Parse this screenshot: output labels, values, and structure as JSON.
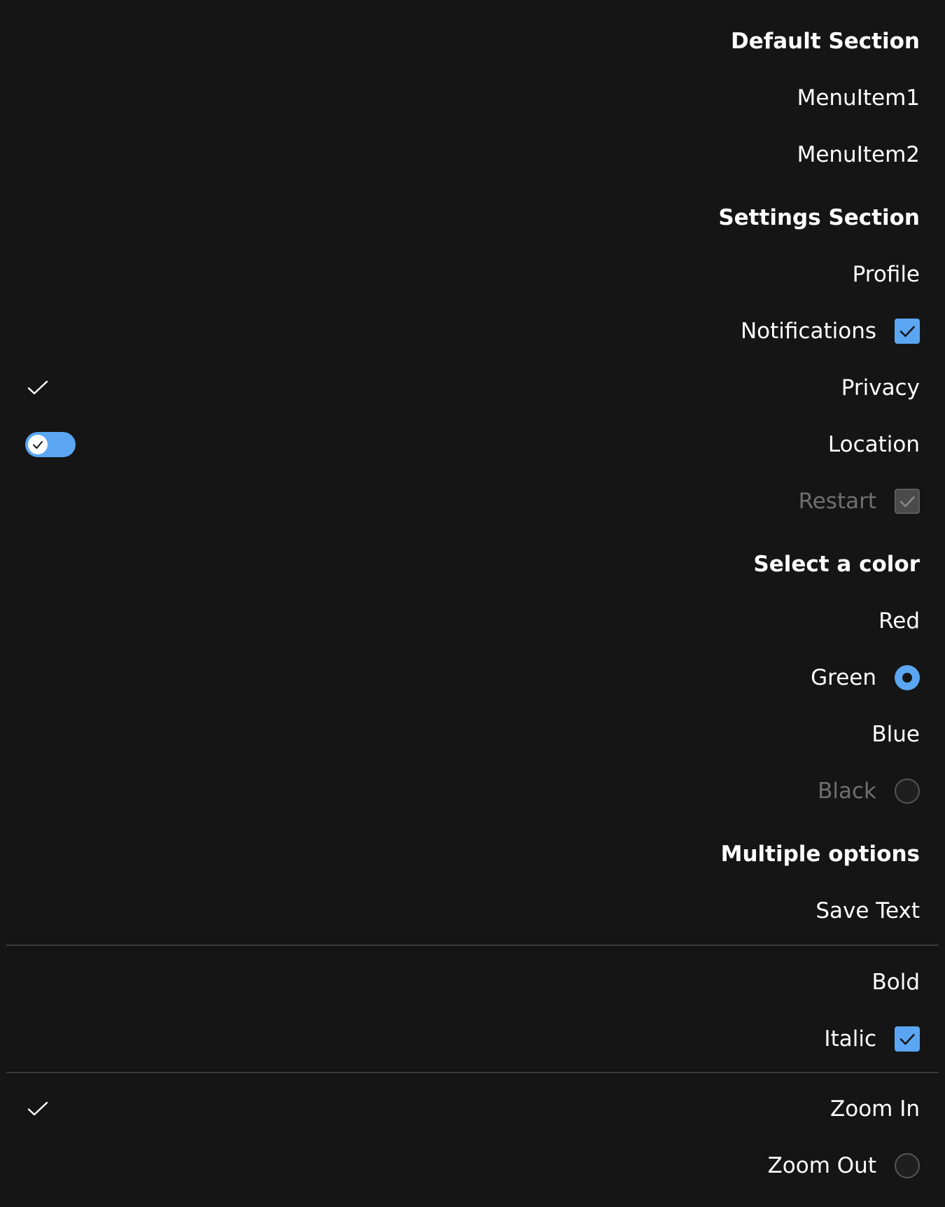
{
  "menu": {
    "default_section": {
      "title": "Default Section",
      "items": [
        "MenuItem1",
        "MenuItem2"
      ]
    },
    "settings_section": {
      "title": "Settings Section",
      "profile": "Profile",
      "notifications": {
        "label": "Notifications",
        "checked": true
      },
      "privacy": {
        "label": "Privacy",
        "leading_check": true
      },
      "location": {
        "label": "Location",
        "toggle_on": true
      },
      "restart": {
        "label": "Restart",
        "checked": true,
        "disabled": true
      }
    },
    "color_section": {
      "title": "Select a color",
      "options": [
        {
          "label": "Red"
        },
        {
          "label": "Green",
          "selected": true
        },
        {
          "label": "Blue"
        },
        {
          "label": "Black",
          "disabled": true
        }
      ]
    },
    "multiple_section": {
      "title": "Multiple options",
      "save_text": "Save Text",
      "bold": "Bold",
      "italic": {
        "label": "Italic",
        "checked": true
      },
      "zoom_in": {
        "label": "Zoom In",
        "leading_check": true
      },
      "zoom_out": {
        "label": "Zoom Out",
        "radio_selected": false
      }
    }
  },
  "colors": {
    "background": "#151515",
    "accent": "#5ba6f2",
    "text": "#ffffff",
    "disabled_text": "#6f6f6f",
    "divider": "#3a3a3a"
  },
  "icons": [
    "checkmark-icon",
    "toggle-switch",
    "checkbox",
    "radio-button"
  ]
}
